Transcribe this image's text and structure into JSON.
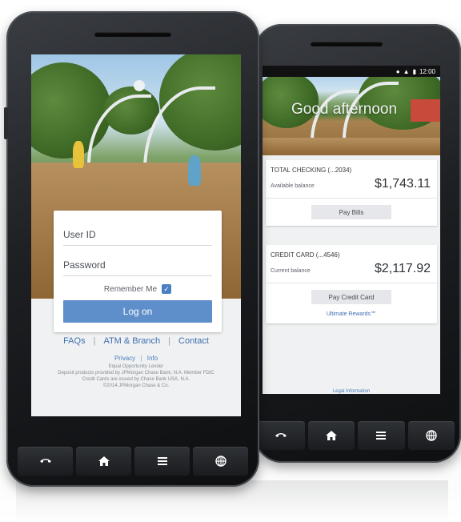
{
  "login_screen": {
    "user_id_placeholder": "User ID",
    "password_placeholder": "Password",
    "remember_label": "Remember Me",
    "remember_checked": true,
    "logon_label": "Log on",
    "links": [
      "FAQs",
      "ATM & Branch",
      "Contact"
    ],
    "small_links": [
      "Privacy",
      "Info"
    ],
    "legal_lines": [
      "Equal Opportunity Lender",
      "Deposit products provided by JPMorgan Chase Bank, N.A. Member FDIC",
      "Credit Cards are issued by Chase Bank USA, N.A.",
      "©2014 JPMorgan Chase & Co."
    ]
  },
  "account_screen": {
    "status_time": "12:00",
    "greeting": "Good afternoon",
    "accounts": [
      {
        "title": "TOTAL CHECKING (...2034)",
        "balance_label": "Available balance",
        "amount": "$1,743.11",
        "action_label": "Pay Bills"
      },
      {
        "title": "CREDIT CARD (...4546)",
        "balance_label": "Current balance",
        "amount": "$2,117.92",
        "action_label": "Pay Credit Card",
        "extra_link": "Ultimate Rewards℠"
      }
    ],
    "footer_link": "Legal Information"
  },
  "nav_icons": [
    "phone-icon",
    "home-icon",
    "menu-icon",
    "globe-icon"
  ],
  "colors": {
    "primary_button": "#5f8fcb",
    "link": "#3f6fb0",
    "phone_body": "#1d1f22"
  }
}
